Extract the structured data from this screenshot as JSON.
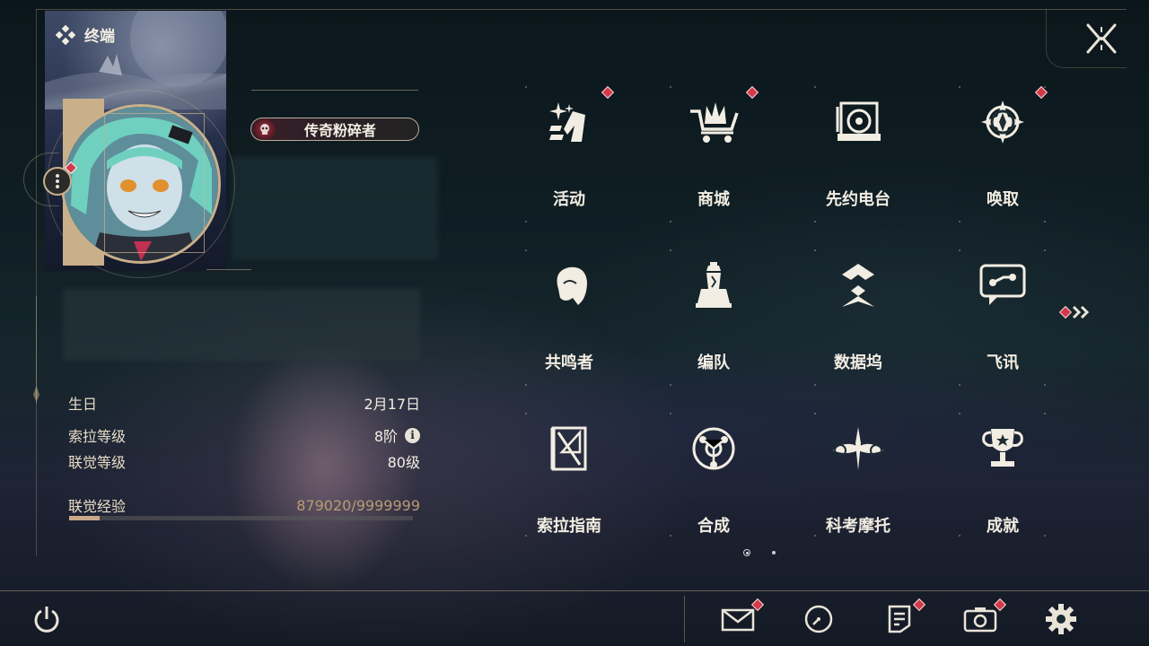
{
  "header": {
    "title": "终端"
  },
  "profile": {
    "title_badge": "传奇粉碎者",
    "stats": [
      {
        "label": "生日",
        "value": "2月17日"
      },
      {
        "label": "索拉等级",
        "value": "8阶"
      },
      {
        "label": "联觉等级",
        "value": "80级"
      },
      {
        "label": "联觉经验",
        "value": "879020/9999999"
      }
    ],
    "exp_fraction": 0.088
  },
  "menu": [
    {
      "label": "活动",
      "icon": "sparkle-icon",
      "badge": true
    },
    {
      "label": "商城",
      "icon": "shop-cart-icon",
      "badge": true
    },
    {
      "label": "先约电台",
      "icon": "radio-icon",
      "badge": false
    },
    {
      "label": "唤取",
      "icon": "compass-star-icon",
      "badge": true
    },
    {
      "label": "共鸣者",
      "icon": "character-silhouette-icon",
      "badge": false
    },
    {
      "label": "编队",
      "icon": "chess-icon",
      "badge": false
    },
    {
      "label": "数据坞",
      "icon": "data-dock-icon",
      "badge": false
    },
    {
      "label": "飞讯",
      "icon": "chat-bubble-icon",
      "badge": false
    },
    {
      "label": "索拉指南",
      "icon": "guide-book-icon",
      "badge": false
    },
    {
      "label": "合成",
      "icon": "synthesis-icon",
      "badge": false
    },
    {
      "label": "科考摩托",
      "icon": "motorcycle-icon",
      "badge": false
    },
    {
      "label": "成就",
      "icon": "trophy-icon",
      "badge": false
    }
  ],
  "colors": {
    "accent_gold": "#c9b08a",
    "badge_red": "#d23a4a",
    "text": "#f2ede2"
  }
}
